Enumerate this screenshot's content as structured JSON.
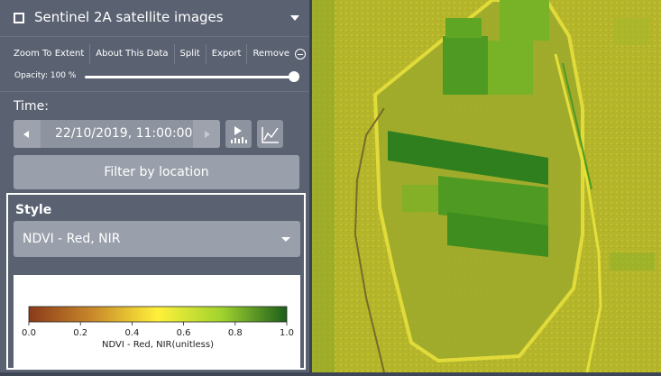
{
  "layer": {
    "title": "Sentinel 2A satellite images",
    "actions": [
      "Zoom To Extent",
      "About This Data",
      "Split",
      "Export",
      "Remove"
    ],
    "opacity_label": "Opacity: 100 %",
    "opacity_value": 100
  },
  "time": {
    "label": "Time:",
    "value": "22/10/2019, 11:00:00"
  },
  "filter_button": "Filter by location",
  "style": {
    "label": "Style",
    "selected": "NDVI - Red, NIR"
  },
  "legend": {
    "ticks": [
      "0.0",
      "0.2",
      "0.4",
      "0.6",
      "0.8",
      "1.0"
    ],
    "title": "NDVI - Red, NIR(unitless)",
    "colors": [
      "#8b3a1a",
      "#c98a2a",
      "#fff13a",
      "#9fd22e",
      "#1b5e1b"
    ]
  },
  "map": {
    "colors": {
      "background": "#b4b52a",
      "field_dark": "#2f7f1e",
      "field_mid": "#4f9a22",
      "field_light": "#78b226",
      "edge": "#e3e03a",
      "road": "#7a6a2a"
    }
  }
}
